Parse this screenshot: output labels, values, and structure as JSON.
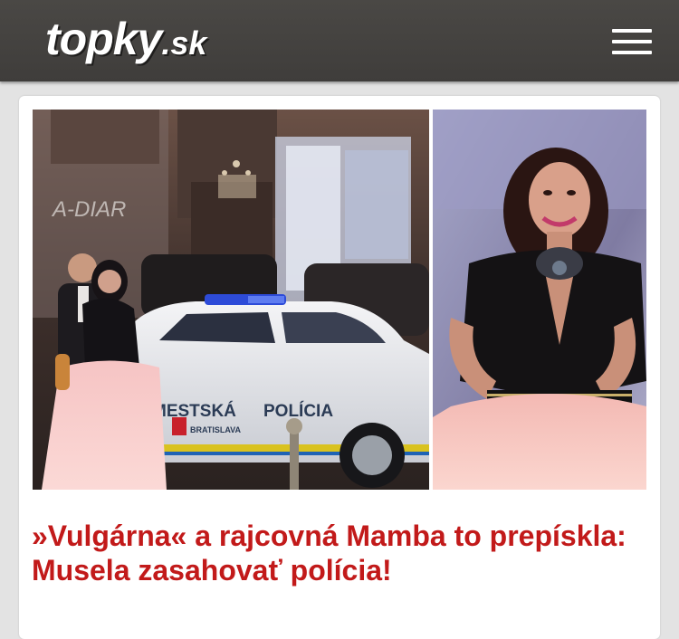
{
  "header": {
    "logo_main": "topky",
    "logo_tld": ".sk",
    "menu_icon": "hamburger-menu-icon",
    "colors": {
      "bar": "#45433f",
      "logo": "#ffffff"
    }
  },
  "article": {
    "left_photo": {
      "car_text_line1": "MESTSKÁ",
      "car_text_line2": "POLÍCIA",
      "car_text_city": "BRATISLAVA",
      "graffiti": "A-DIAR"
    },
    "headline": "»Vulgárna« a rajcovná Mamba to prepískla: Musela zasahovať polícia!",
    "headline_color": "#c21a1a"
  }
}
